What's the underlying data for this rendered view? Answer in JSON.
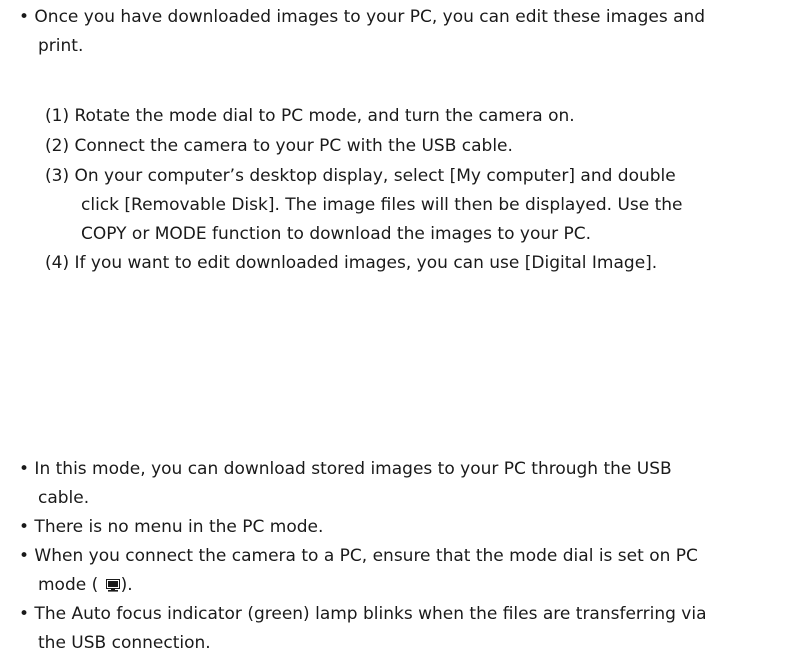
{
  "intro": {
    "bullet_line1": "• Once you have downloaded images to your PC, you can edit these images and",
    "bullet_line2": "print."
  },
  "steps": {
    "s1": "(1) Rotate the mode dial to PC mode, and turn the camera on.",
    "s2": "(2) Connect the camera to your PC with the USB cable.",
    "s3_line1": "(3) On your computer’s desktop display, select [My computer] and double",
    "s3_line2": "click [Removable Disk]. The image files will then be displayed. Use the",
    "s3_line3": "COPY or MODE function to download the images to your PC.",
    "s4": "(4) If you want to edit downloaded images, you can use [Digital Image]."
  },
  "notes": {
    "n1_line1": "• In this mode, you can download stored images to your PC through the USB",
    "n1_line2": "cable.",
    "n2": "• There is no menu in the PC mode.",
    "n3_line1": "• When you connect the camera to a PC, ensure that the mode dial is set on PC",
    "n3_line2_prefix": "mode (",
    "n3_line2_suffix": ").",
    "n3_icon": "pc-monitor-icon",
    "n4_line1": "• The Auto focus indicator (green) lamp blinks when the files are transferring via",
    "n4_line2": "the USB connection."
  }
}
